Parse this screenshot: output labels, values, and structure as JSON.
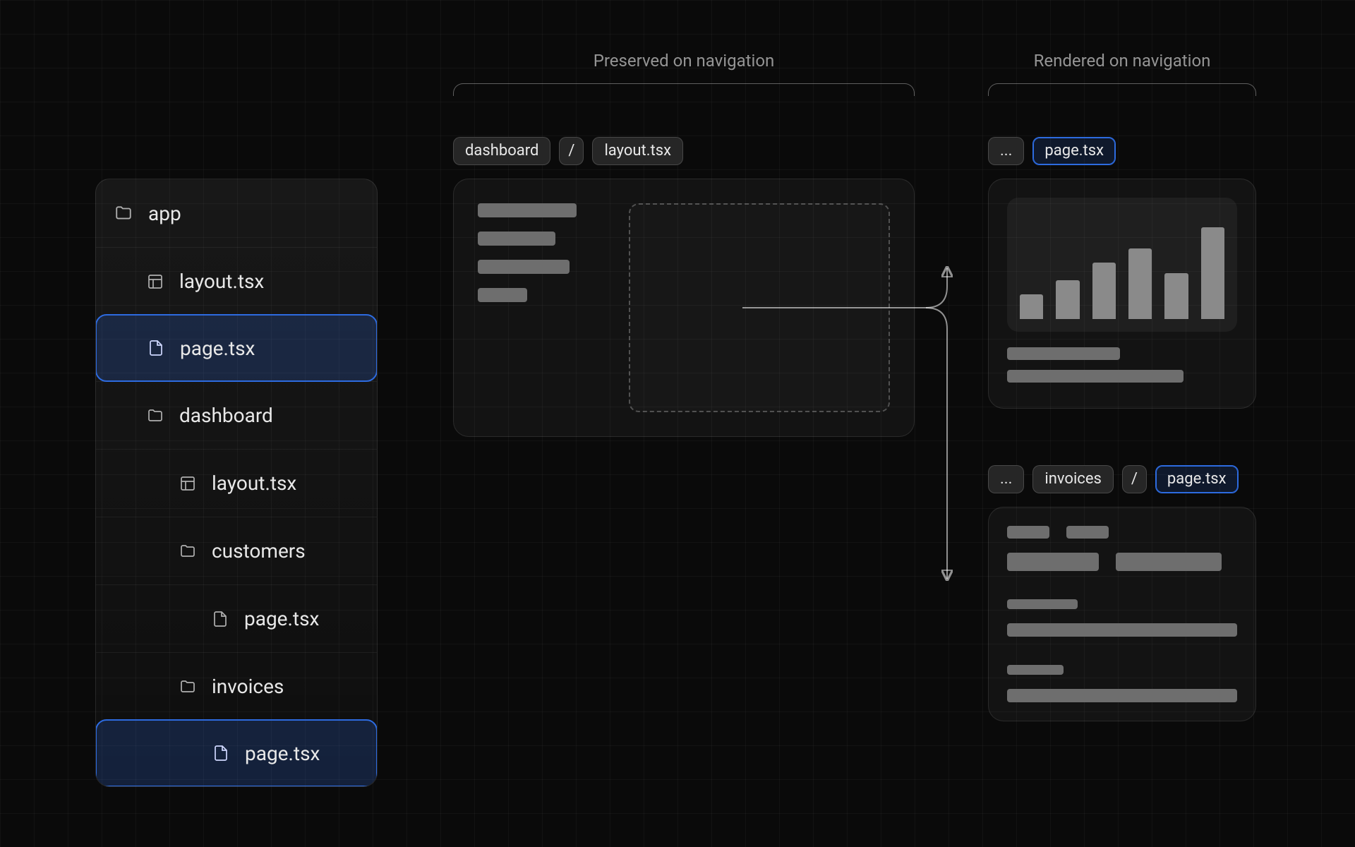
{
  "sections": {
    "preserved": "Preserved on navigation",
    "rendered": "Rendered on navigation"
  },
  "tree": [
    {
      "label": "app",
      "icon": "folder",
      "depth": 0,
      "selected": false
    },
    {
      "label": "layout.tsx",
      "icon": "layout",
      "depth": 1,
      "selected": false
    },
    {
      "label": "page.tsx",
      "icon": "file",
      "depth": 1,
      "selected": true
    },
    {
      "label": "dashboard",
      "icon": "folder",
      "depth": 1,
      "selected": false
    },
    {
      "label": "layout.tsx",
      "icon": "layout",
      "depth": 2,
      "selected": false
    },
    {
      "label": "customers",
      "icon": "folder",
      "depth": 2,
      "selected": false
    },
    {
      "label": "page.tsx",
      "icon": "file",
      "depth": 3,
      "selected": false
    },
    {
      "label": "invoices",
      "icon": "folder",
      "depth": 2,
      "selected": false
    },
    {
      "label": "page.tsx",
      "icon": "file",
      "depth": 3,
      "selected": true
    }
  ],
  "crumbs": {
    "layout": [
      "dashboard",
      "/",
      "layout.tsx"
    ],
    "render1": [
      "...",
      "page.tsx"
    ],
    "render2": [
      "...",
      "invoices",
      "/",
      "page.tsx"
    ]
  },
  "chart_bars": [
    35,
    55,
    80,
    100,
    65,
    130
  ],
  "colors": {
    "accent": "#2d6be0"
  }
}
